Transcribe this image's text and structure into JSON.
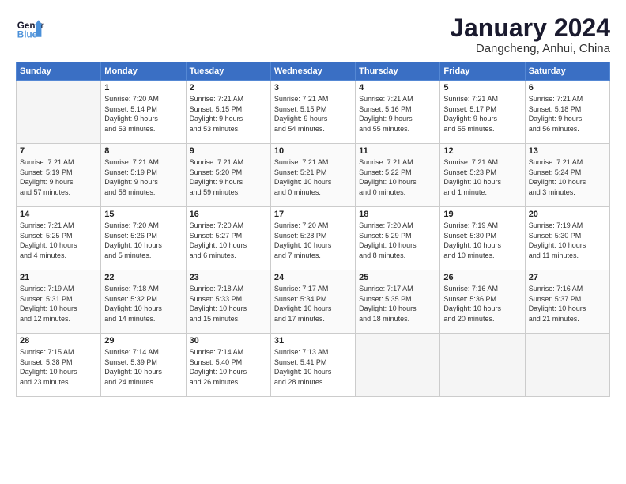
{
  "header": {
    "logo_line1": "General",
    "logo_line2": "Blue",
    "month": "January 2024",
    "location": "Dangcheng, Anhui, China"
  },
  "weekdays": [
    "Sunday",
    "Monday",
    "Tuesday",
    "Wednesday",
    "Thursday",
    "Friday",
    "Saturday"
  ],
  "weeks": [
    [
      {
        "day": "",
        "content": ""
      },
      {
        "day": "1",
        "content": "Sunrise: 7:20 AM\nSunset: 5:14 PM\nDaylight: 9 hours\nand 53 minutes."
      },
      {
        "day": "2",
        "content": "Sunrise: 7:21 AM\nSunset: 5:15 PM\nDaylight: 9 hours\nand 53 minutes."
      },
      {
        "day": "3",
        "content": "Sunrise: 7:21 AM\nSunset: 5:15 PM\nDaylight: 9 hours\nand 54 minutes."
      },
      {
        "day": "4",
        "content": "Sunrise: 7:21 AM\nSunset: 5:16 PM\nDaylight: 9 hours\nand 55 minutes."
      },
      {
        "day": "5",
        "content": "Sunrise: 7:21 AM\nSunset: 5:17 PM\nDaylight: 9 hours\nand 55 minutes."
      },
      {
        "day": "6",
        "content": "Sunrise: 7:21 AM\nSunset: 5:18 PM\nDaylight: 9 hours\nand 56 minutes."
      }
    ],
    [
      {
        "day": "7",
        "content": "Sunrise: 7:21 AM\nSunset: 5:19 PM\nDaylight: 9 hours\nand 57 minutes."
      },
      {
        "day": "8",
        "content": "Sunrise: 7:21 AM\nSunset: 5:19 PM\nDaylight: 9 hours\nand 58 minutes."
      },
      {
        "day": "9",
        "content": "Sunrise: 7:21 AM\nSunset: 5:20 PM\nDaylight: 9 hours\nand 59 minutes."
      },
      {
        "day": "10",
        "content": "Sunrise: 7:21 AM\nSunset: 5:21 PM\nDaylight: 10 hours\nand 0 minutes."
      },
      {
        "day": "11",
        "content": "Sunrise: 7:21 AM\nSunset: 5:22 PM\nDaylight: 10 hours\nand 0 minutes."
      },
      {
        "day": "12",
        "content": "Sunrise: 7:21 AM\nSunset: 5:23 PM\nDaylight: 10 hours\nand 1 minute."
      },
      {
        "day": "13",
        "content": "Sunrise: 7:21 AM\nSunset: 5:24 PM\nDaylight: 10 hours\nand 3 minutes."
      }
    ],
    [
      {
        "day": "14",
        "content": "Sunrise: 7:21 AM\nSunset: 5:25 PM\nDaylight: 10 hours\nand 4 minutes."
      },
      {
        "day": "15",
        "content": "Sunrise: 7:20 AM\nSunset: 5:26 PM\nDaylight: 10 hours\nand 5 minutes."
      },
      {
        "day": "16",
        "content": "Sunrise: 7:20 AM\nSunset: 5:27 PM\nDaylight: 10 hours\nand 6 minutes."
      },
      {
        "day": "17",
        "content": "Sunrise: 7:20 AM\nSunset: 5:28 PM\nDaylight: 10 hours\nand 7 minutes."
      },
      {
        "day": "18",
        "content": "Sunrise: 7:20 AM\nSunset: 5:29 PM\nDaylight: 10 hours\nand 8 minutes."
      },
      {
        "day": "19",
        "content": "Sunrise: 7:19 AM\nSunset: 5:30 PM\nDaylight: 10 hours\nand 10 minutes."
      },
      {
        "day": "20",
        "content": "Sunrise: 7:19 AM\nSunset: 5:30 PM\nDaylight: 10 hours\nand 11 minutes."
      }
    ],
    [
      {
        "day": "21",
        "content": "Sunrise: 7:19 AM\nSunset: 5:31 PM\nDaylight: 10 hours\nand 12 minutes."
      },
      {
        "day": "22",
        "content": "Sunrise: 7:18 AM\nSunset: 5:32 PM\nDaylight: 10 hours\nand 14 minutes."
      },
      {
        "day": "23",
        "content": "Sunrise: 7:18 AM\nSunset: 5:33 PM\nDaylight: 10 hours\nand 15 minutes."
      },
      {
        "day": "24",
        "content": "Sunrise: 7:17 AM\nSunset: 5:34 PM\nDaylight: 10 hours\nand 17 minutes."
      },
      {
        "day": "25",
        "content": "Sunrise: 7:17 AM\nSunset: 5:35 PM\nDaylight: 10 hours\nand 18 minutes."
      },
      {
        "day": "26",
        "content": "Sunrise: 7:16 AM\nSunset: 5:36 PM\nDaylight: 10 hours\nand 20 minutes."
      },
      {
        "day": "27",
        "content": "Sunrise: 7:16 AM\nSunset: 5:37 PM\nDaylight: 10 hours\nand 21 minutes."
      }
    ],
    [
      {
        "day": "28",
        "content": "Sunrise: 7:15 AM\nSunset: 5:38 PM\nDaylight: 10 hours\nand 23 minutes."
      },
      {
        "day": "29",
        "content": "Sunrise: 7:14 AM\nSunset: 5:39 PM\nDaylight: 10 hours\nand 24 minutes."
      },
      {
        "day": "30",
        "content": "Sunrise: 7:14 AM\nSunset: 5:40 PM\nDaylight: 10 hours\nand 26 minutes."
      },
      {
        "day": "31",
        "content": "Sunrise: 7:13 AM\nSunset: 5:41 PM\nDaylight: 10 hours\nand 28 minutes."
      },
      {
        "day": "",
        "content": ""
      },
      {
        "day": "",
        "content": ""
      },
      {
        "day": "",
        "content": ""
      }
    ]
  ]
}
